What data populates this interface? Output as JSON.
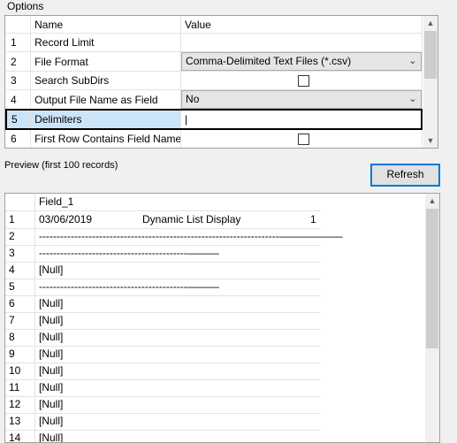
{
  "options_label": "Options",
  "grid": {
    "header": {
      "name": "Name",
      "value": "Value"
    },
    "rows": [
      {
        "num": "1",
        "name": "Record Limit",
        "value": "",
        "kind": "text"
      },
      {
        "num": "2",
        "name": "File Format",
        "value": "Comma-Delimited Text Files (*.csv)",
        "kind": "combo"
      },
      {
        "num": "3",
        "name": "Search SubDirs",
        "value": "",
        "kind": "check"
      },
      {
        "num": "4",
        "name": "Output File Name as Field",
        "value": "No",
        "kind": "combo"
      },
      {
        "num": "5",
        "name": "Delimiters",
        "value": "|",
        "kind": "edit"
      },
      {
        "num": "6",
        "name": "First Row Contains Field Names",
        "value": "",
        "kind": "check"
      }
    ]
  },
  "preview": {
    "label": "Preview (first 100 records)",
    "refresh_label": "Refresh",
    "column_header": "Field_1",
    "rows": [
      {
        "num": "1",
        "value": "03/06/2019",
        "mid": "Dynamic List Display",
        "right": "1"
      },
      {
        "num": "2",
        "value": "--------------------------------------------------------------------——————"
      },
      {
        "num": "3",
        "value": "------------------------------------------———"
      },
      {
        "num": "4",
        "value": "[Null]"
      },
      {
        "num": "5",
        "value": "------------------------------------------———"
      },
      {
        "num": "6",
        "value": "[Null]"
      },
      {
        "num": "7",
        "value": "[Null]"
      },
      {
        "num": "8",
        "value": "[Null]"
      },
      {
        "num": "9",
        "value": "[Null]"
      },
      {
        "num": "10",
        "value": "[Null]"
      },
      {
        "num": "11",
        "value": "[Null]"
      },
      {
        "num": "12",
        "value": "[Null]"
      },
      {
        "num": "13",
        "value": "[Null]"
      },
      {
        "num": "14",
        "value": "[Null]"
      }
    ]
  }
}
